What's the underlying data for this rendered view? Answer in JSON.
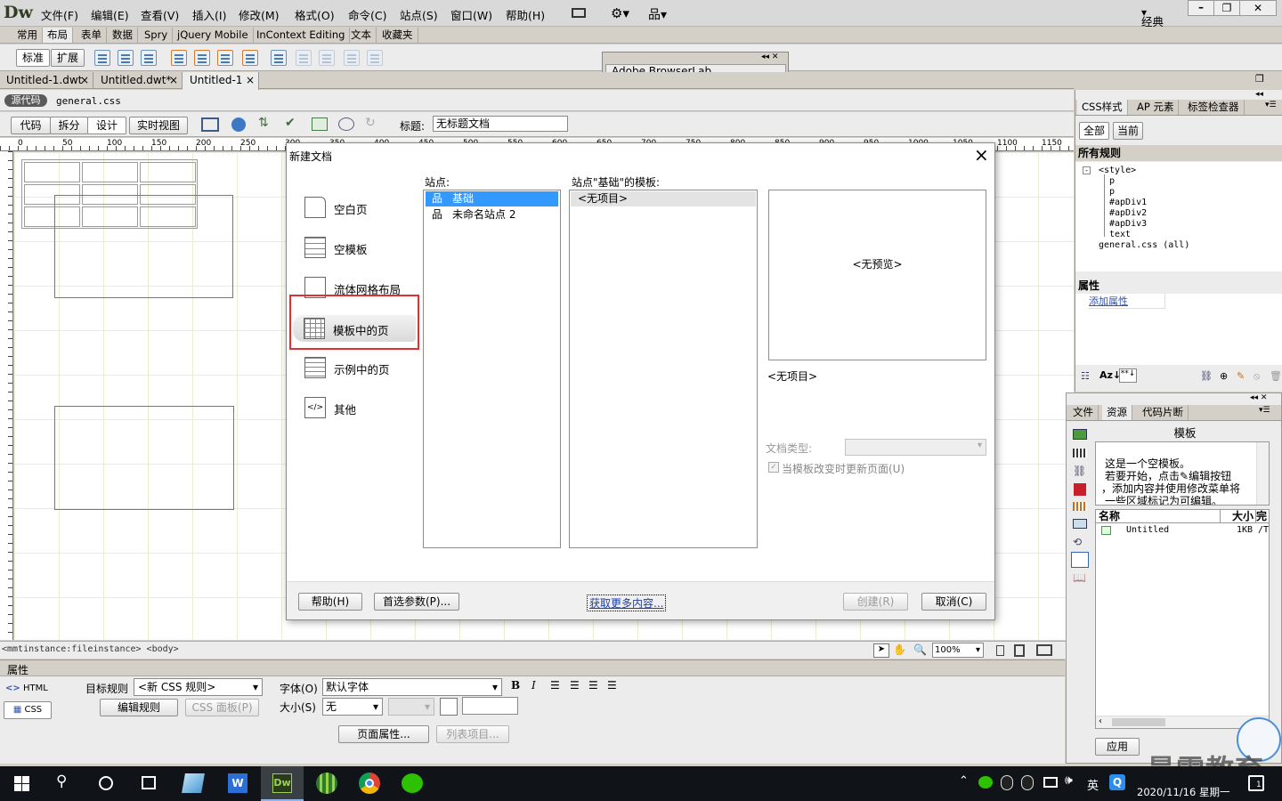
{
  "app": {
    "logo": "Dw",
    "workspace": "经典"
  },
  "menu": [
    "文件(F)",
    "编辑(E)",
    "查看(V)",
    "插入(I)",
    "修改(M)",
    "格式(O)",
    "命令(C)",
    "站点(S)",
    "窗口(W)",
    "帮助(H)"
  ],
  "insert_tabs": [
    "常用",
    "布局",
    "表单",
    "数据",
    "Spry",
    "jQuery Mobile",
    "InContext Editing",
    "文本",
    "收藏夹"
  ],
  "layout_buttons": {
    "standard": "标准",
    "expanded": "扩展"
  },
  "browserlab": {
    "title": "Adobe BrowserLab"
  },
  "doc_tabs": [
    {
      "label": "Untitled-1.dwt",
      "close": "×"
    },
    {
      "label": "Untitled.dwt*",
      "close": "×"
    },
    {
      "label": "Untitled-1",
      "close": "×"
    }
  ],
  "related": {
    "source": "源代码",
    "file": "general.css"
  },
  "view_buttons": {
    "code": "代码",
    "split": "拆分",
    "design": "设计",
    "live": "实时视图"
  },
  "title_field": {
    "label": "标题:",
    "value": "无标题文档"
  },
  "ruler_labels": [
    "0",
    "50",
    "100",
    "150",
    "200",
    "250",
    "300",
    "350",
    "400",
    "450",
    "500",
    "550",
    "600",
    "650",
    "700",
    "750",
    "800",
    "850",
    "900",
    "950",
    "1000",
    "1050",
    "1100",
    "1150"
  ],
  "status": {
    "tags": "<mmtinstance:fileinstance> <body>",
    "zoom": "100%"
  },
  "dialog": {
    "title": "新建文档",
    "close": "×",
    "categories": [
      "空白页",
      "空模板",
      "流体网格布局",
      "模板中的页",
      "示例中的页",
      "其他"
    ],
    "sites_label": "站点:",
    "sites": [
      "基础",
      "未命名站点 2"
    ],
    "templates_label": "站点\"基础\"的模板:",
    "templates": [
      "<无项目>"
    ],
    "preview": "<无预览>",
    "item_label": "<无项目>",
    "doctype_label": "文档类型:",
    "update_checkbox": "当模板改变时更新页面(U)",
    "help_button": "帮助(H)",
    "prefs_button": "首选参数(P)...",
    "more_link": "获取更多内容...",
    "create_button": "创建(R)",
    "cancel_button": "取消(C)"
  },
  "css_panel": {
    "tabs": [
      "CSS样式",
      "AP 元素",
      "标签检查器"
    ],
    "mode_all": "全部",
    "mode_current": "当前",
    "all_rules_header": "所有规则",
    "rules": [
      "<style>",
      "p",
      "p",
      "#apDiv1",
      "#apDiv2",
      "#apDiv3",
      "text",
      "general.css (all)"
    ],
    "props_header": "属性",
    "add_property": "添加属性"
  },
  "files_panel": {
    "tabs": [
      "文件",
      "资源",
      "代码片断"
    ],
    "header": "模板",
    "desc": [
      "这是一个空模板。",
      "若要开始，点击",
      "编辑按钮",
      "，添加内容并使用修改菜单将",
      "一些区域标记为可编辑。"
    ],
    "col_name": "名称",
    "col_size": "大小",
    "col_extra": "完",
    "row_name": "Untitled",
    "row_size": "1KB",
    "row_extra": "/T",
    "apply": "应用"
  },
  "props_panel": {
    "title": "属性",
    "html": "HTML",
    "css": "CSS",
    "target_rule_label": "目标规则",
    "target_rule_value": "<新 CSS 规则>",
    "edit_rule": "编辑规则",
    "css_panel_btn": "CSS 面板(P)",
    "font_label": "字体(O)",
    "font_value": "默认字体",
    "size_label": "大小(S)",
    "size_value": "无",
    "bold": "B",
    "italic": "I",
    "page_props": "页面属性...",
    "list_items": "列表项目..."
  },
  "taskbar": {
    "ime": "英",
    "date": "2020/11/16 星期一",
    "badge": "1"
  },
  "watermark": "最需教育"
}
